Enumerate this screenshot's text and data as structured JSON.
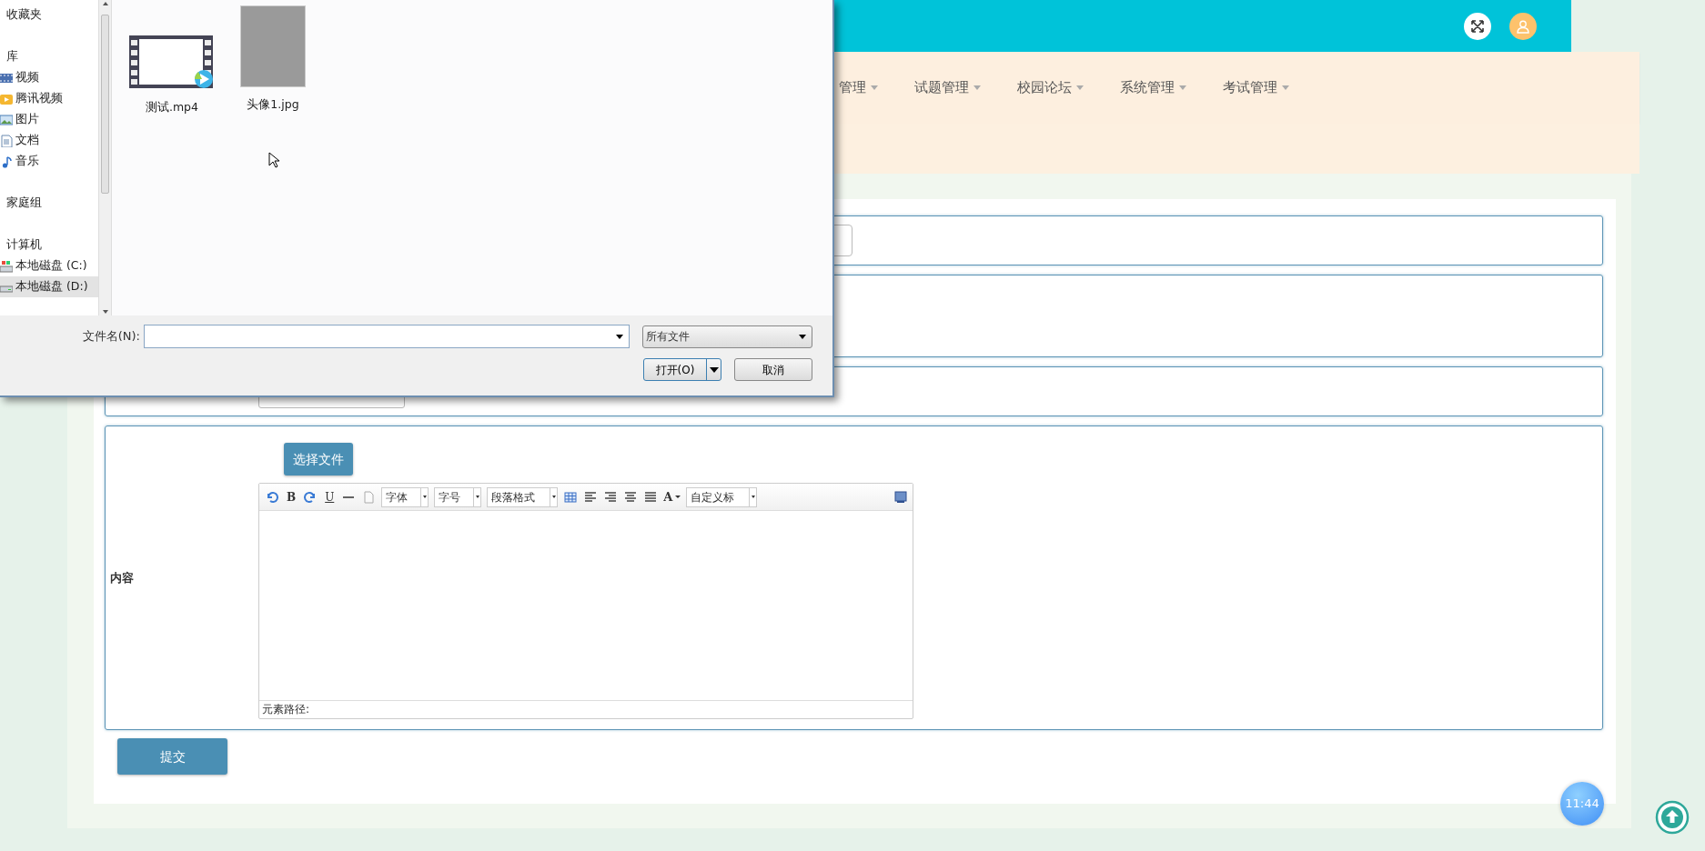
{
  "dialog": {
    "sidebar": {
      "items": [
        {
          "label": "收藏夹",
          "selected": false
        },
        {
          "label": "库",
          "selected": false,
          "children": [
            {
              "label": "视频",
              "kind": "video",
              "selected": false
            },
            {
              "label": "腾讯视频",
              "kind": "player",
              "selected": false
            },
            {
              "label": "图片",
              "kind": "picture",
              "selected": false
            },
            {
              "label": "文档",
              "kind": "document",
              "selected": false
            },
            {
              "label": "音乐",
              "kind": "music",
              "selected": false
            }
          ]
        },
        {
          "label": "家庭组",
          "selected": false
        },
        {
          "label": "计算机",
          "selected": false,
          "children": [
            {
              "label": "本地磁盘 (C:)",
              "kind": "system-drive",
              "selected": false
            },
            {
              "label": "本地磁盘 (D:)",
              "kind": "drive",
              "selected": true
            }
          ]
        }
      ]
    },
    "files": [
      {
        "name": "测试.mp4",
        "kind": "video"
      },
      {
        "name": "头像1.jpg",
        "kind": "image"
      }
    ],
    "filename_label": "文件名(N):",
    "filter": "所有文件",
    "buttons": [
      {
        "label": "打开(O)",
        "kind": "split"
      },
      {
        "label": "取消",
        "kind": "plain"
      }
    ]
  },
  "nav": {
    "items": [
      {
        "label": "管理",
        "dropdown": true
      },
      {
        "label": "试题管理",
        "dropdown": true
      },
      {
        "label": "校园论坛",
        "dropdown": true
      },
      {
        "label": "系统管理",
        "dropdown": true
      },
      {
        "label": "考试管理",
        "dropdown": true
      }
    ]
  },
  "form": {
    "content_label": "内容",
    "upload_button": "选择文件",
    "editor": {
      "toolbar": [
        {
          "kind": "undo"
        },
        {
          "kind": "bold",
          "text": "B"
        },
        {
          "kind": "redo"
        },
        {
          "kind": "underline",
          "text": "U"
        },
        {
          "kind": "rule"
        },
        {
          "kind": "clear"
        },
        {
          "kind": "select",
          "text": "字体"
        },
        {
          "kind": "select",
          "text": "字号"
        },
        {
          "kind": "select",
          "text": "段落格式"
        },
        {
          "kind": "table"
        },
        {
          "kind": "align-left"
        },
        {
          "kind": "align-right"
        },
        {
          "kind": "align-center"
        },
        {
          "kind": "justify"
        },
        {
          "kind": "color",
          "text": "A"
        },
        {
          "kind": "select",
          "text": "自定义标"
        }
      ],
      "status": "元素路径:"
    },
    "submit": "提交"
  },
  "clock": "11:44"
}
